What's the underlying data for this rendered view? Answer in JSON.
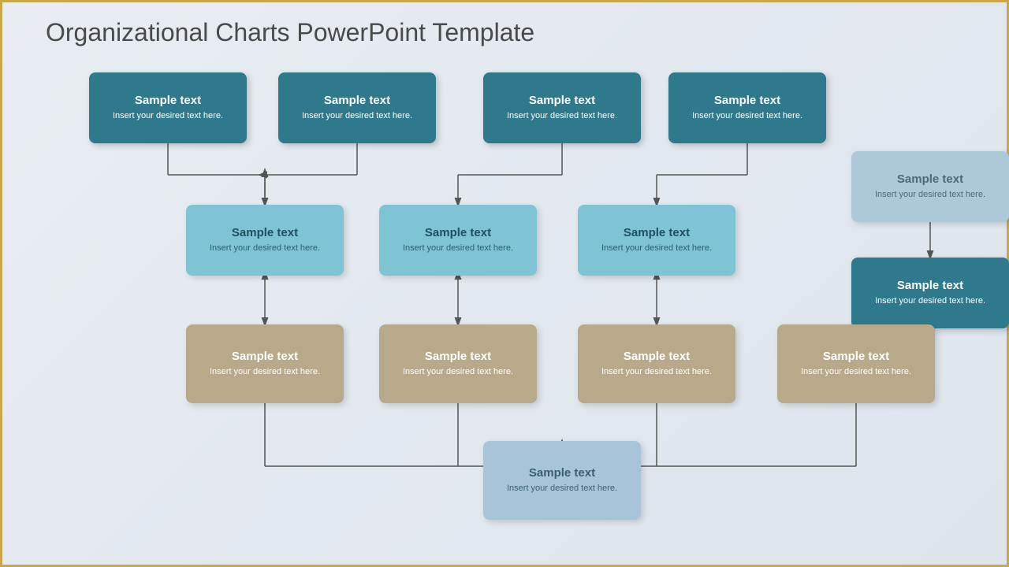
{
  "title": "Organizational Charts PowerPoint Template",
  "boxes": {
    "top_row": [
      {
        "id": "t1",
        "title": "Sample text",
        "sub": "Insert your desired\ntext here."
      },
      {
        "id": "t2",
        "title": "Sample text",
        "sub": "Insert your desired\ntext here."
      },
      {
        "id": "t3",
        "title": "Sample text",
        "sub": "Insert your desired\ntext here."
      },
      {
        "id": "t4",
        "title": "Sample text",
        "sub": "Insert your desired\ntext here."
      }
    ],
    "mid_row": [
      {
        "id": "m1",
        "title": "Sample text",
        "sub": "Insert your desired\ntext here."
      },
      {
        "id": "m2",
        "title": "Sample text",
        "sub": "Insert your desired\ntext here."
      },
      {
        "id": "m3",
        "title": "Sample text",
        "sub": "Insert your desired\ntext here."
      }
    ],
    "low_row": [
      {
        "id": "l1",
        "title": "Sample text",
        "sub": "Insert your desired\ntext here."
      },
      {
        "id": "l2",
        "title": "Sample text",
        "sub": "Insert your desired\ntext here."
      },
      {
        "id": "l3",
        "title": "Sample text",
        "sub": "Insert your desired\ntext here."
      },
      {
        "id": "l4",
        "title": "Sample text",
        "sub": "Insert your desired\ntext here."
      }
    ],
    "right_top": {
      "id": "rt",
      "title": "Sample text",
      "sub": "Insert your desired\ntext here."
    },
    "right_bot": {
      "id": "rb",
      "title": "Sample text",
      "sub": "Insert your desired\ntext here."
    },
    "bottom": {
      "id": "bot",
      "title": "Sample text",
      "sub": "Insert your desired\ntext here."
    }
  }
}
